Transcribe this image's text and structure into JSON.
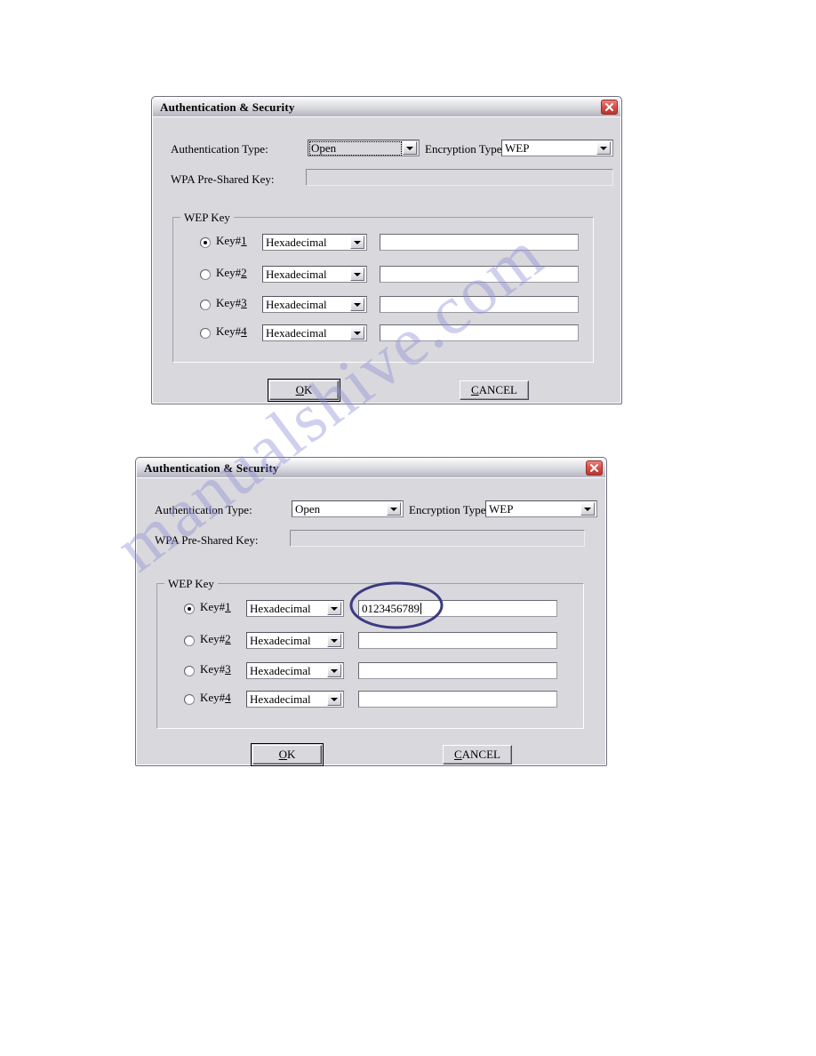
{
  "watermark": {
    "text": "manualshive.com"
  },
  "dialogs": [
    {
      "title": "Authentication & Security",
      "close_label": "Close",
      "auth_type_label": "Authentication Type:",
      "auth_type_value": "Open",
      "encryption_type_label": "Encryption Type:",
      "encryption_type_value": "WEP",
      "wpa_label": "WPA Pre-Shared Key:",
      "wpa_value": "",
      "wep_group_label": "WEP Key",
      "keys": [
        {
          "label_prefix": "Key#",
          "label_mnemonic": "1",
          "selected": true,
          "format": "Hexadecimal",
          "value": ""
        },
        {
          "label_prefix": "Key#",
          "label_mnemonic": "2",
          "selected": false,
          "format": "Hexadecimal",
          "value": ""
        },
        {
          "label_prefix": "Key#",
          "label_mnemonic": "3",
          "selected": false,
          "format": "Hexadecimal",
          "value": ""
        },
        {
          "label_prefix": "Key#",
          "label_mnemonic": "4",
          "selected": false,
          "format": "Hexadecimal",
          "value": ""
        }
      ],
      "ok_mnemonic": "O",
      "ok_rest": "K",
      "cancel_mnemonic": "C",
      "cancel_rest": "ANCEL"
    },
    {
      "title": "Authentication & Security",
      "close_label": "Close",
      "auth_type_label": "Authentication Type:",
      "auth_type_value": "Open",
      "encryption_type_label": "Encryption Type:",
      "encryption_type_value": "WEP",
      "wpa_label": "WPA Pre-Shared Key:",
      "wpa_value": "",
      "wep_group_label": "WEP Key",
      "keys": [
        {
          "label_prefix": "Key#",
          "label_mnemonic": "1",
          "selected": true,
          "format": "Hexadecimal",
          "value": "0123456789"
        },
        {
          "label_prefix": "Key#",
          "label_mnemonic": "2",
          "selected": false,
          "format": "Hexadecimal",
          "value": ""
        },
        {
          "label_prefix": "Key#",
          "label_mnemonic": "3",
          "selected": false,
          "format": "Hexadecimal",
          "value": ""
        },
        {
          "label_prefix": "Key#",
          "label_mnemonic": "4",
          "selected": false,
          "format": "Hexadecimal",
          "value": ""
        }
      ],
      "ok_mnemonic": "O",
      "ok_rest": "K",
      "cancel_mnemonic": "C",
      "cancel_rest": "ANCEL"
    }
  ],
  "annotation": {
    "shape": "ellipse",
    "color": "#3b3b82",
    "target": "key1-value-field"
  }
}
